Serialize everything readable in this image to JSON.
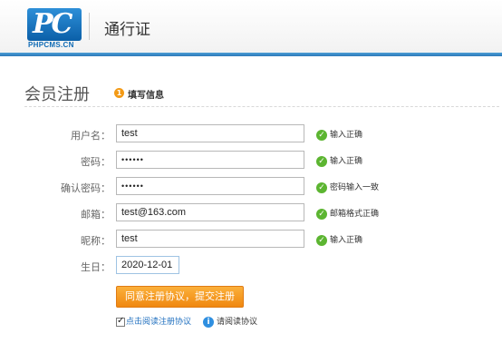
{
  "header": {
    "logo_mark": "PC",
    "logo_text": "PHPCMS.CN",
    "site_title": "通行证"
  },
  "section": {
    "title": "会员注册",
    "step_number": "1",
    "step_label": "填写信息"
  },
  "form": {
    "username": {
      "label": "用户名：",
      "value": "test",
      "tip": "输入正确"
    },
    "password": {
      "label": "密码：",
      "value": "••••••",
      "tip": "输入正确"
    },
    "confirm_password": {
      "label": "确认密码：",
      "value": "••••••",
      "tip": "密码输入一致"
    },
    "email": {
      "label": "邮箱：",
      "value": "test@163.com",
      "tip": "邮箱格式正确"
    },
    "nickname": {
      "label": "昵称：",
      "value": "test",
      "tip": "输入正确"
    },
    "birthday": {
      "label": "生日：",
      "value": "2020-12-01"
    }
  },
  "actions": {
    "submit_label": "同意注册协议，提交注册",
    "agree_label": "点击阅读注册协议",
    "read_tip": "请阅读协议"
  },
  "colors": {
    "accent_blue": "#2c78b8",
    "ok_green": "#5cb531",
    "submit_orange": "#f08810",
    "info_blue": "#2f8fe0"
  },
  "icons": {
    "ok": "check-circle-icon",
    "info": "info-circle-icon",
    "step": "step-number-badge"
  }
}
